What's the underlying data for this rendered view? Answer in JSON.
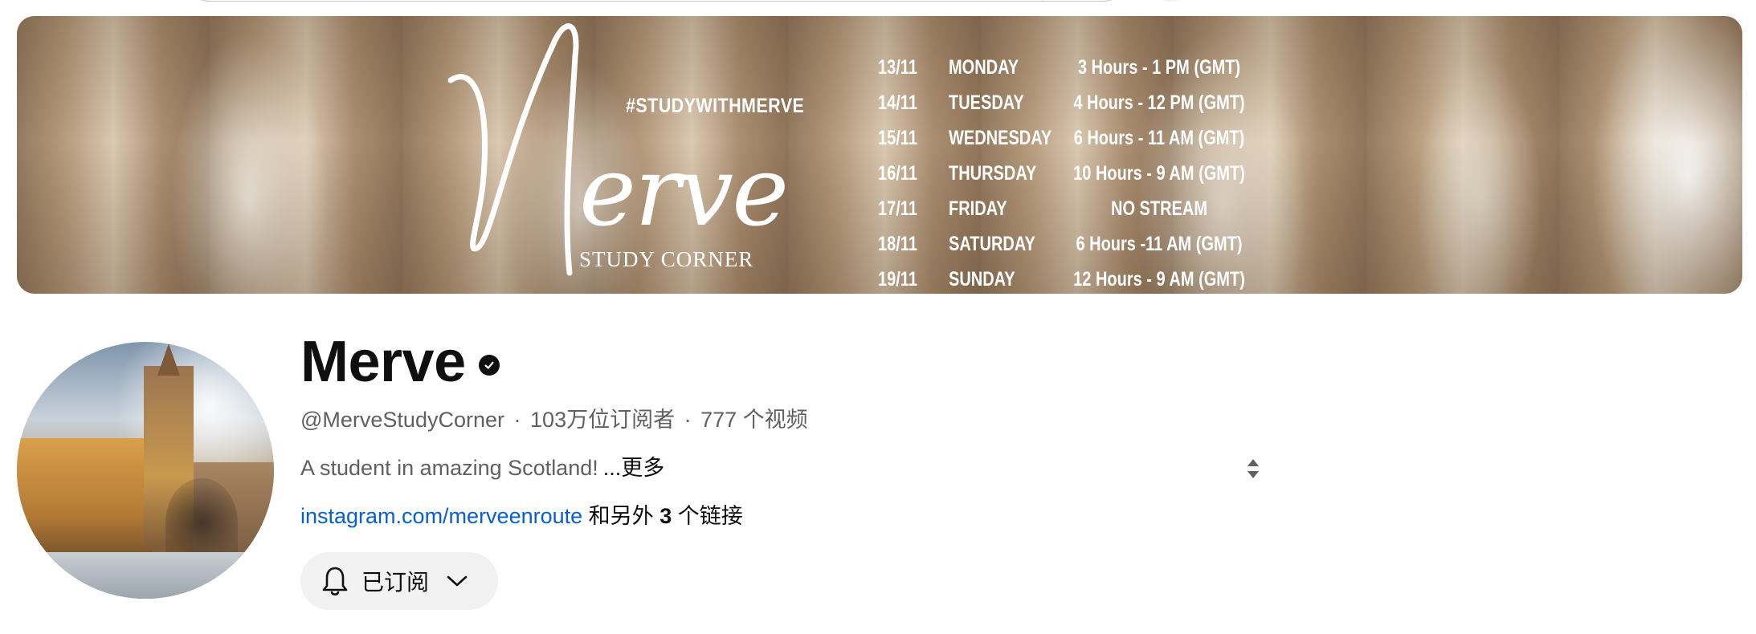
{
  "banner": {
    "logo_initial": "M",
    "logo_rest": "erve",
    "logo_subtitle": "STUDY CORNER",
    "hashtag": "#STUDYWITHMERVE",
    "schedule": [
      {
        "date": "13/11",
        "day": "MONDAY",
        "hours": "3 Hours - 1 PM (GMT)"
      },
      {
        "date": "14/11",
        "day": "TUESDAY",
        "hours": "4 Hours - 12 PM (GMT)"
      },
      {
        "date": "15/11",
        "day": "WEDNESDAY",
        "hours": "6 Hours - 11 AM (GMT)"
      },
      {
        "date": "16/11",
        "day": "THURSDAY",
        "hours": "10 Hours - 9 AM (GMT)"
      },
      {
        "date": "17/11",
        "day": "FRIDAY",
        "hours": "NO STREAM"
      },
      {
        "date": "18/11",
        "day": "SATURDAY",
        "hours": "6 Hours -11 AM (GMT)"
      },
      {
        "date": "19/11",
        "day": "SUNDAY",
        "hours": "12 Hours - 9 AM (GMT)"
      }
    ]
  },
  "channel": {
    "name": "Merve",
    "handle": "@MerveStudyCorner",
    "subscribers": "103万位订阅者",
    "videos": "777 个视频",
    "separator": "·",
    "description": "A student in amazing Scotland!",
    "more_label": "...更多",
    "link_text": "instagram.com/merveenroute",
    "links_prefix": "和另外",
    "links_count": "3",
    "links_suffix": "个链接"
  },
  "subscribe": {
    "label": "已订阅",
    "icon": "bell-icon"
  },
  "colors": {
    "link": "#065fd4",
    "button_bg": "#f2f2f2",
    "secondary_text": "#606060"
  }
}
